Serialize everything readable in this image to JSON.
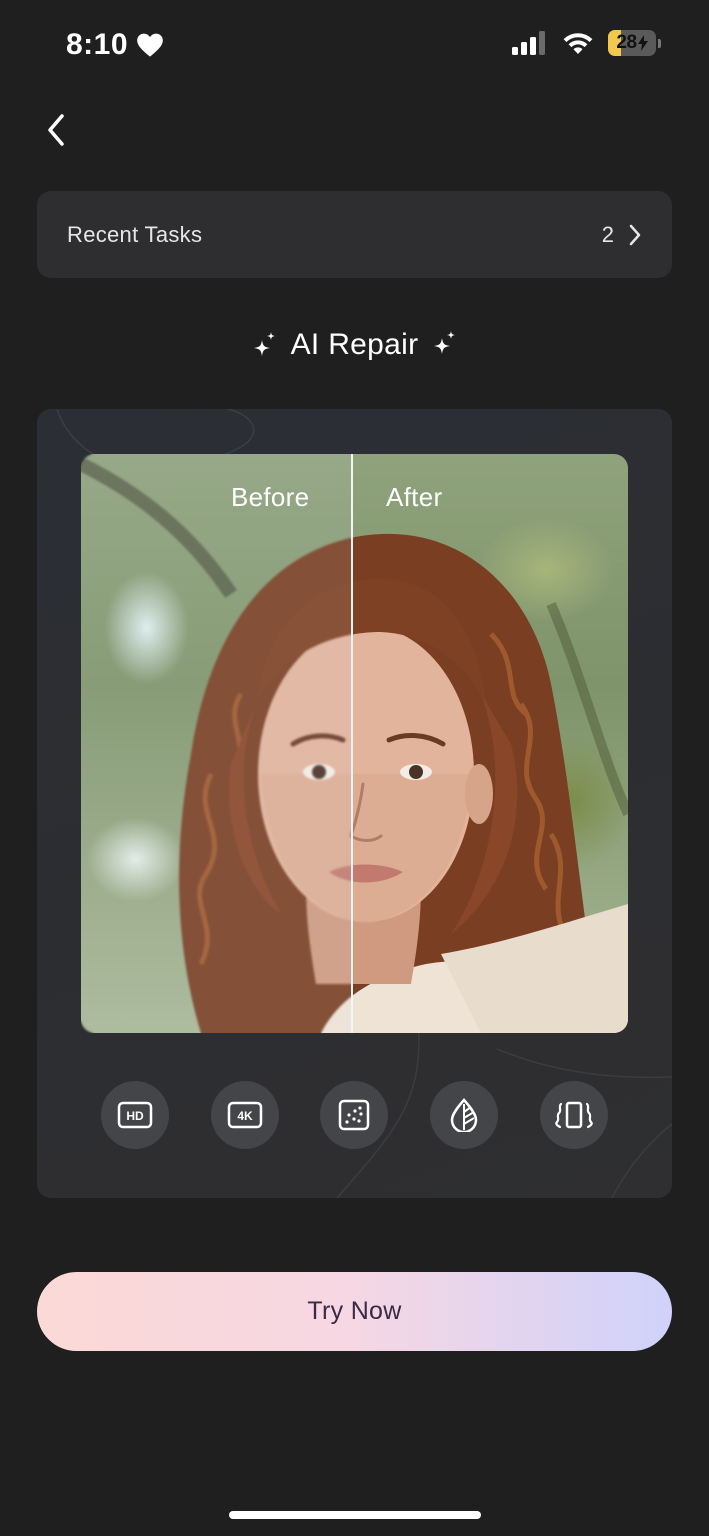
{
  "status_bar": {
    "time": "8:10",
    "battery_level": "28",
    "battery_fraction": 0.28,
    "icons": [
      "heart-icon",
      "cellular-signal-icon",
      "wifi-icon",
      "battery-charging-icon"
    ]
  },
  "nav": {
    "back_icon": "chevron-left-icon"
  },
  "recent_tasks": {
    "label": "Recent Tasks",
    "count": "2",
    "icon": "chevron-right-icon"
  },
  "feature": {
    "title": "AI Repair",
    "icons": [
      "sparkle-icon",
      "sparkle-icon"
    ]
  },
  "preview": {
    "before_label": "Before",
    "after_label": "After"
  },
  "tools": [
    {
      "name": "hd",
      "icon": "hd-icon",
      "label": "HD"
    },
    {
      "name": "4k",
      "icon": "4k-icon",
      "label": "4K"
    },
    {
      "name": "denoise",
      "icon": "noise-icon"
    },
    {
      "name": "color",
      "icon": "leaf-drop-icon"
    },
    {
      "name": "stabilize",
      "icon": "vibrate-icon"
    }
  ],
  "cta": {
    "label": "Try Now"
  },
  "colors": {
    "background": "#1f1f1f",
    "card": "#2e2e30",
    "tool_bg": "#444548",
    "cta_gradient_start": "#fbd9d6",
    "cta_gradient_end": "#cfd2fb",
    "cta_text": "#3a2a45",
    "battery_fill": "#f2c94c"
  }
}
